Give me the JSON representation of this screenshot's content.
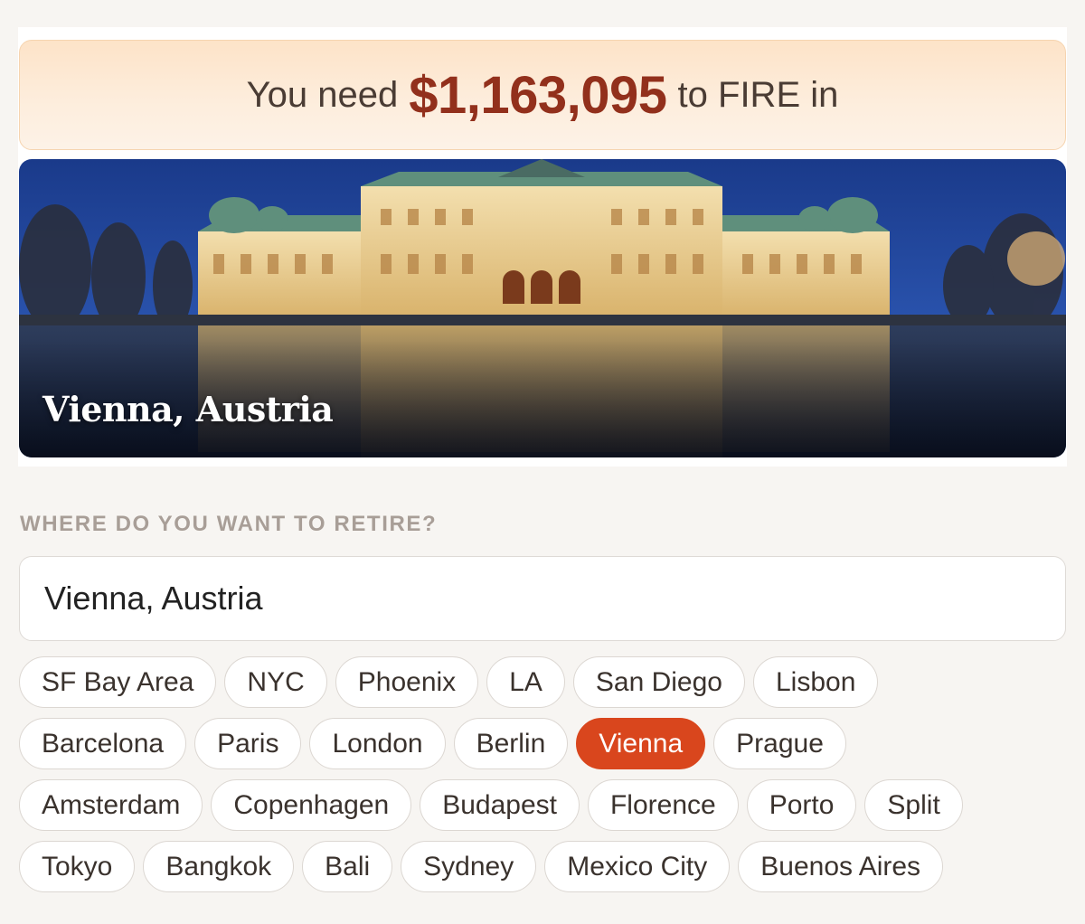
{
  "banner": {
    "prefix": "You need",
    "amount": "$1,163,095",
    "suffix": "to FIRE in"
  },
  "hero": {
    "caption": "Vienna, Austria"
  },
  "location": {
    "label": "WHERE DO YOU WANT TO RETIRE?",
    "value": "Vienna, Austria"
  },
  "cities": {
    "selected": "Vienna",
    "rows": [
      [
        "SF Bay Area",
        "NYC",
        "Phoenix",
        "LA",
        "San Diego",
        "Lisbon"
      ],
      [
        "Barcelona",
        "Paris",
        "London",
        "Berlin",
        "Vienna",
        "Prague"
      ],
      [
        "Amsterdam",
        "Copenhagen",
        "Budapest",
        "Florence",
        "Porto",
        "Split"
      ],
      [
        "Tokyo",
        "Bangkok",
        "Bali",
        "Sydney",
        "Mexico City",
        "Buenos Aires"
      ]
    ]
  },
  "colors": {
    "accent": "#d9461d",
    "amount": "#92301c"
  }
}
